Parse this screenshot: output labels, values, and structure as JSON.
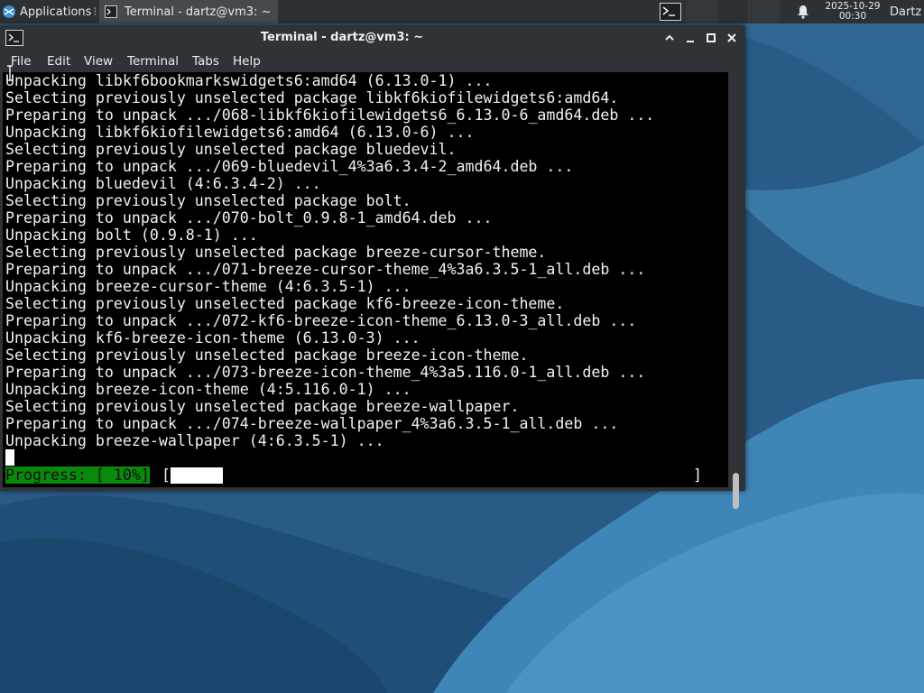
{
  "panel": {
    "applications_label": "Applications",
    "task_title": "Terminal - dartz@vm3: ~",
    "clock_date": "2025-10-29",
    "clock_time": "00:30",
    "user": "Dartz"
  },
  "window": {
    "title": "Terminal - dartz@vm3: ~"
  },
  "menu": {
    "file": "File",
    "edit": "Edit",
    "view": "View",
    "terminal": "Terminal",
    "tabs": "Tabs",
    "help": "Help"
  },
  "terminal": {
    "lines": [
      "Unpacking libkf6bookmarkswidgets6:amd64 (6.13.0-1) ...",
      "Selecting previously unselected package libkf6kiofilewidgets6:amd64.",
      "Preparing to unpack .../068-libkf6kiofilewidgets6_6.13.0-6_amd64.deb ...",
      "Unpacking libkf6kiofilewidgets6:amd64 (6.13.0-6) ...",
      "Selecting previously unselected package bluedevil.",
      "Preparing to unpack .../069-bluedevil_4%3a6.3.4-2_amd64.deb ...",
      "Unpacking bluedevil (4:6.3.4-2) ...",
      "Selecting previously unselected package bolt.",
      "Preparing to unpack .../070-bolt_0.9.8-1_amd64.deb ...",
      "Unpacking bolt (0.9.8-1) ...",
      "Selecting previously unselected package breeze-cursor-theme.",
      "Preparing to unpack .../071-breeze-cursor-theme_4%3a6.3.5-1_all.deb ...",
      "Unpacking breeze-cursor-theme (4:6.3.5-1) ...",
      "Selecting previously unselected package kf6-breeze-icon-theme.",
      "Preparing to unpack .../072-kf6-breeze-icon-theme_6.13.0-3_all.deb ...",
      "Unpacking kf6-breeze-icon-theme (6.13.0-3) ...",
      "Selecting previously unselected package breeze-icon-theme.",
      "Preparing to unpack .../073-breeze-icon-theme_4%3a5.116.0-1_all.deb ...",
      "Unpacking breeze-icon-theme (4:5.116.0-1) ...",
      "Selecting previously unselected package breeze-wallpaper.",
      "Preparing to unpack .../074-breeze-wallpaper_4%3a6.3.5-1_all.deb ...",
      "Unpacking breeze-wallpaper (4:6.3.5-1) ..."
    ],
    "progress_label": "Progress: [ 10%]",
    "bracket_open": "[",
    "bracket_close": "]",
    "progress_fraction": 0.1
  },
  "colors": {
    "progress_label_bg": "#0a8a0a",
    "terminal_bg": "#000000",
    "panel_bg": "#2e3134"
  },
  "icons": {
    "applications": "xfce-logo-icon",
    "task": "terminal-icon",
    "launcher": "terminal-icon",
    "notifications": "bell-icon"
  }
}
